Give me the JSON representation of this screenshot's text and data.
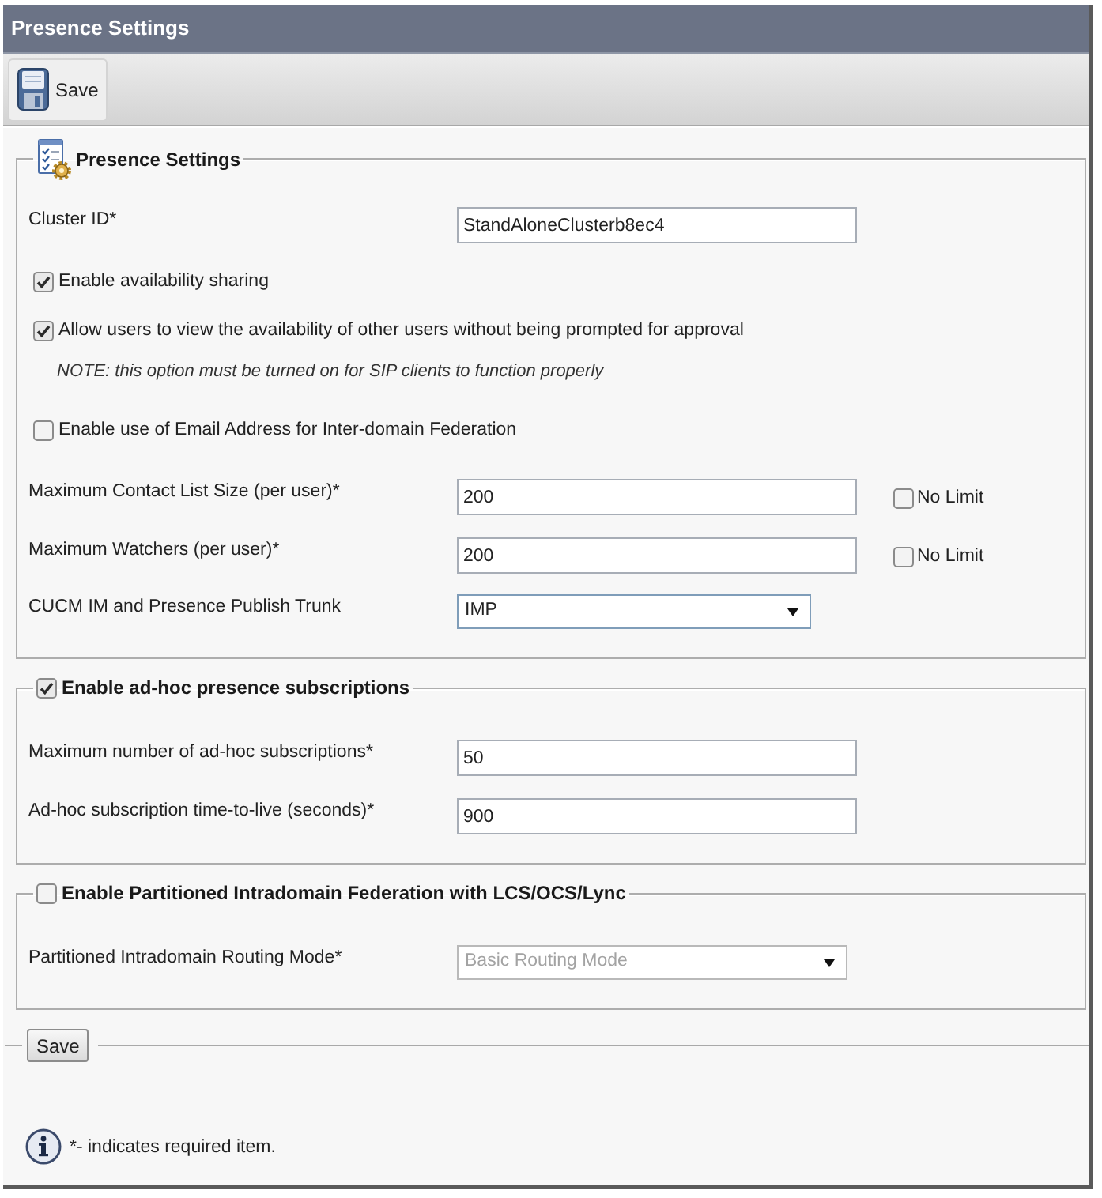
{
  "window": {
    "title": "Presence Settings"
  },
  "toolbar": {
    "buttons": [
      {
        "label": "Save"
      }
    ]
  },
  "sections": [
    {
      "kind": "plain",
      "title": "Presence Settings",
      "rows": [
        {
          "kind": "text",
          "label": "Cluster ID*",
          "value": "StandAloneClusterb8ec4"
        },
        {
          "kind": "checkbox",
          "label": "Enable availability sharing",
          "checked": true
        },
        {
          "kind": "checkbox",
          "label": "Allow users to view the availability of other users without being prompted for approval",
          "checked": true
        },
        {
          "kind": "note",
          "text": "NOTE: this option must be turned on for SIP clients to function properly"
        },
        {
          "kind": "checkbox",
          "label": "Enable use of Email Address for Inter-domain Federation",
          "checked": false
        },
        {
          "kind": "text",
          "label": "Maximum Contact List Size (per user)*",
          "value": "200",
          "option": {
            "label": "No Limit",
            "checked": false
          }
        },
        {
          "kind": "text",
          "label": "Maximum Watchers (per user)*",
          "value": "200",
          "option": {
            "label": "No Limit",
            "checked": false
          }
        },
        {
          "kind": "select",
          "label": "CUCM IM and Presence Publish Trunk",
          "value": "IMP",
          "disabled": false
        }
      ]
    },
    {
      "kind": "toggle",
      "title": "Enable ad-hoc presence subscriptions",
      "checked": true,
      "rows": [
        {
          "kind": "text",
          "label": "Maximum number of ad-hoc subscriptions*",
          "value": "50"
        },
        {
          "kind": "text",
          "label": "Ad-hoc subscription time-to-live (seconds)*",
          "value": "900"
        }
      ]
    },
    {
      "kind": "toggle",
      "title": "Enable Partitioned Intradomain Federation with LCS/OCS/Lync",
      "checked": false,
      "rows": [
        {
          "kind": "select",
          "label": "Partitioned Intradomain Routing Mode*",
          "value": "Basic Routing Mode",
          "disabled": true
        }
      ]
    }
  ],
  "footer": {
    "button": {
      "label": "Save"
    },
    "legend": "*- indicates required item."
  }
}
